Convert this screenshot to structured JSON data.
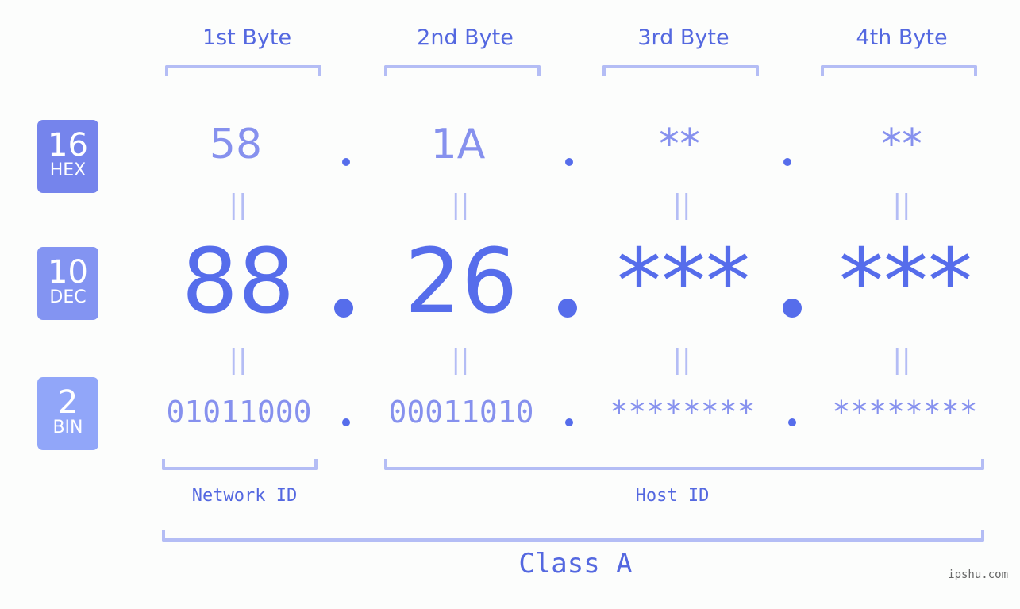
{
  "ip_diagram": {
    "byte_headers": [
      "1st Byte",
      "2nd Byte",
      "3rd Byte",
      "4th Byte"
    ],
    "badges": [
      {
        "number": "16",
        "label": "HEX",
        "color": "#7584ec"
      },
      {
        "number": "10",
        "label": "DEC",
        "color": "#8394f2"
      },
      {
        "number": "2",
        "label": "BIN",
        "color": "#91a6f9"
      }
    ],
    "hex": [
      "58",
      "1A",
      "**",
      "**"
    ],
    "dec": [
      "88",
      "26",
      "***",
      "***"
    ],
    "bin": [
      "01011000",
      "00011010",
      "********",
      "********"
    ],
    "equals_symbol": "||",
    "separator": ".",
    "network_id_label": "Network ID",
    "host_id_label": "Host ID",
    "class_label": "Class A",
    "watermark": "ipshu.com",
    "colors": {
      "primary": "#566deb",
      "secondary": "#8691ee",
      "bracket": "#b4bdf5",
      "background": "#fcfdfc"
    }
  }
}
